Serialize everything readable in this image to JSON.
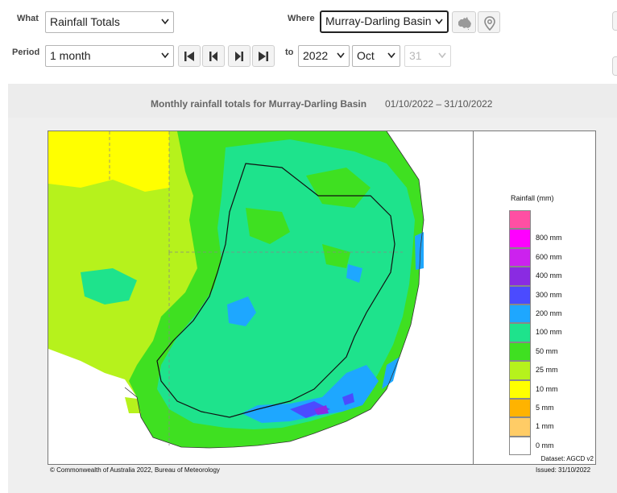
{
  "controls": {
    "what_label": "What",
    "what_value": "Rainfall Totals",
    "where_label": "Where",
    "where_value": "Murray-Darling Basin",
    "period_label": "Period",
    "period_value": "1 month",
    "to_label": "to",
    "year_value": "2022",
    "month_value": "Oct",
    "day_value": "31"
  },
  "title": {
    "main": "Monthly rainfall totals for Murray-Darling Basin",
    "range": "01/10/2022 – 31/10/2022"
  },
  "legend": {
    "title": "Rainfall (mm)",
    "bins": [
      {
        "color": "#ff4fa3",
        "label": ""
      },
      {
        "color": "#ff00ff",
        "label": "800 mm"
      },
      {
        "color": "#cc22ee",
        "label": "600 mm"
      },
      {
        "color": "#8a2be2",
        "label": "400 mm"
      },
      {
        "color": "#4b4bff",
        "label": "300 mm"
      },
      {
        "color": "#1ea7ff",
        "label": "200 mm"
      },
      {
        "color": "#1ee38c",
        "label": "100 mm"
      },
      {
        "color": "#3fe021",
        "label": "50 mm"
      },
      {
        "color": "#b6f21c",
        "label": "25 mm"
      },
      {
        "color": "#ffff00",
        "label": "10 mm"
      },
      {
        "color": "#ffb300",
        "label": "5 mm"
      },
      {
        "color": "#ffcc66",
        "label": "1 mm"
      },
      {
        "color": "#ffffff",
        "label": "0 mm"
      }
    ]
  },
  "map_colors": {
    "yellow": "#ffff00",
    "lime": "#b6f21c",
    "green": "#3fe021",
    "teal": "#1ee38c",
    "blue": "#1ea7ff",
    "indigo": "#4b4bff",
    "violet": "#8a2be2"
  },
  "dataset": "Dataset: AGCD v2",
  "copyright": "© Commonwealth of Australia 2022, Bureau of Meteorology",
  "issued": "Issued: 31/10/2022"
}
